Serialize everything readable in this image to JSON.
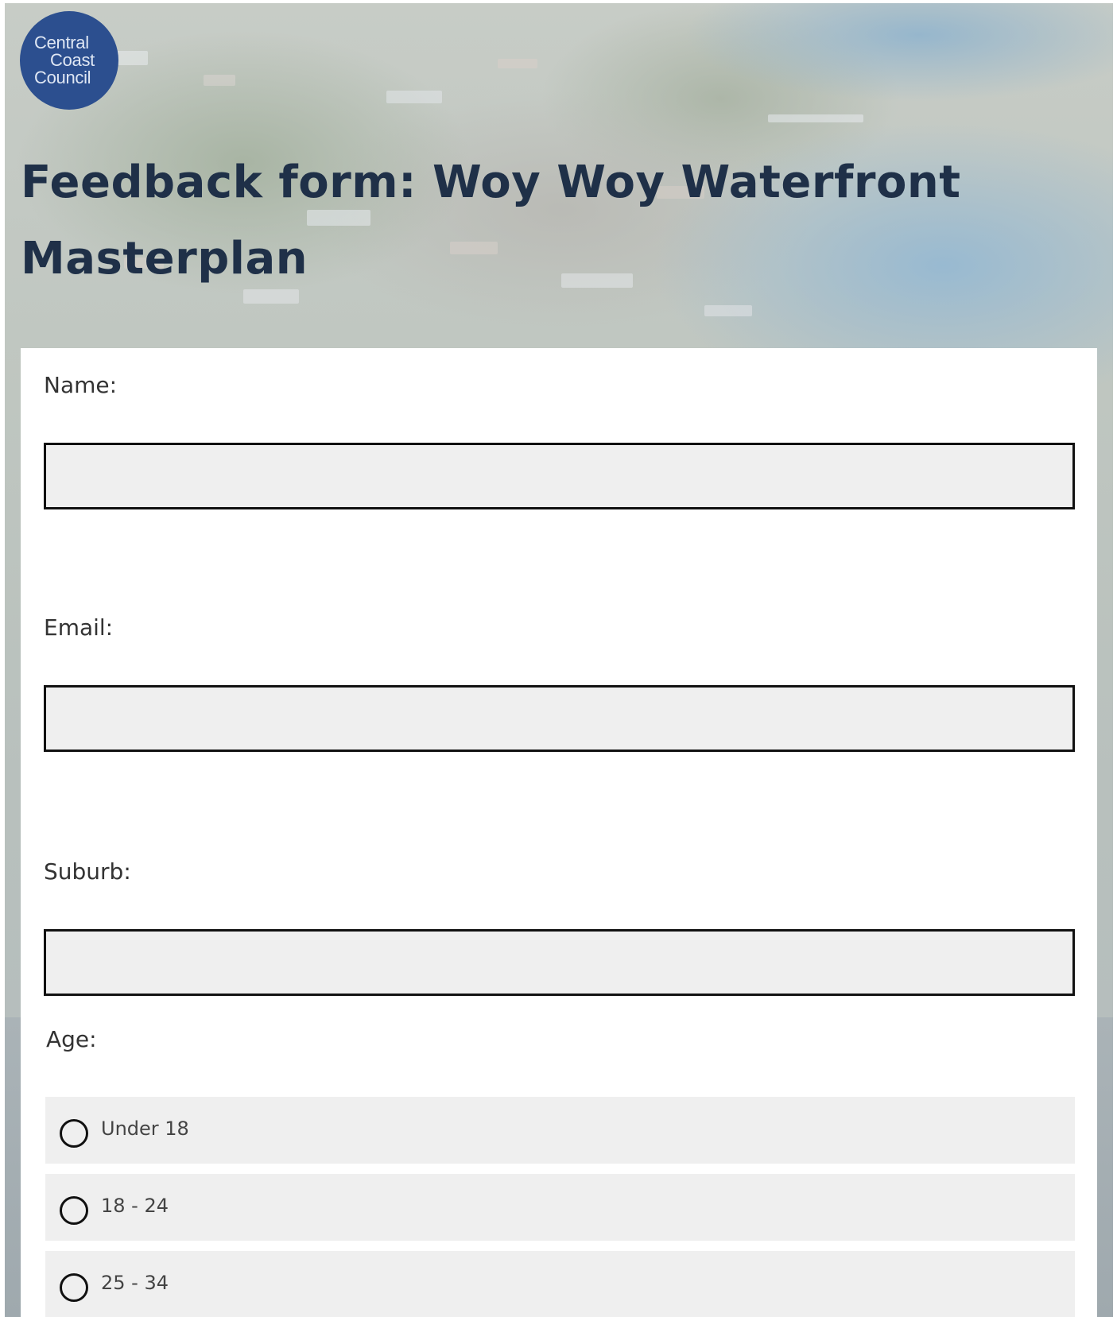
{
  "branding": {
    "logo_lines": [
      "Central",
      "Coast",
      "Council"
    ],
    "logo_color": "#2c4f8f"
  },
  "page": {
    "title": "Feedback form: Woy Woy Waterfront Masterplan",
    "title_color": "#1f3048"
  },
  "form": {
    "name": {
      "label": "Name:",
      "value": "",
      "placeholder": ""
    },
    "email": {
      "label": "Email:",
      "value": "",
      "placeholder": ""
    },
    "suburb": {
      "label": "Suburb:",
      "value": "",
      "placeholder": ""
    },
    "age": {
      "label": "Age:",
      "options": [
        {
          "label": "Under 18",
          "selected": false
        },
        {
          "label": "18 - 24",
          "selected": false
        },
        {
          "label": "25 - 34",
          "selected": false
        }
      ]
    }
  },
  "colors": {
    "input_background": "#efefef",
    "input_border": "#111111",
    "card_background": "#ffffff"
  }
}
